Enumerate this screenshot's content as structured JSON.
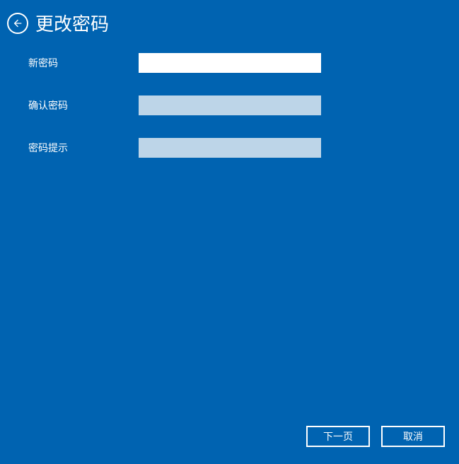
{
  "header": {
    "title": "更改密码"
  },
  "form": {
    "new_password": {
      "label": "新密码",
      "value": ""
    },
    "confirm_password": {
      "label": "确认密码",
      "value": ""
    },
    "password_hint": {
      "label": "密码提示",
      "value": ""
    }
  },
  "buttons": {
    "next": "下一页",
    "cancel": "取消"
  }
}
